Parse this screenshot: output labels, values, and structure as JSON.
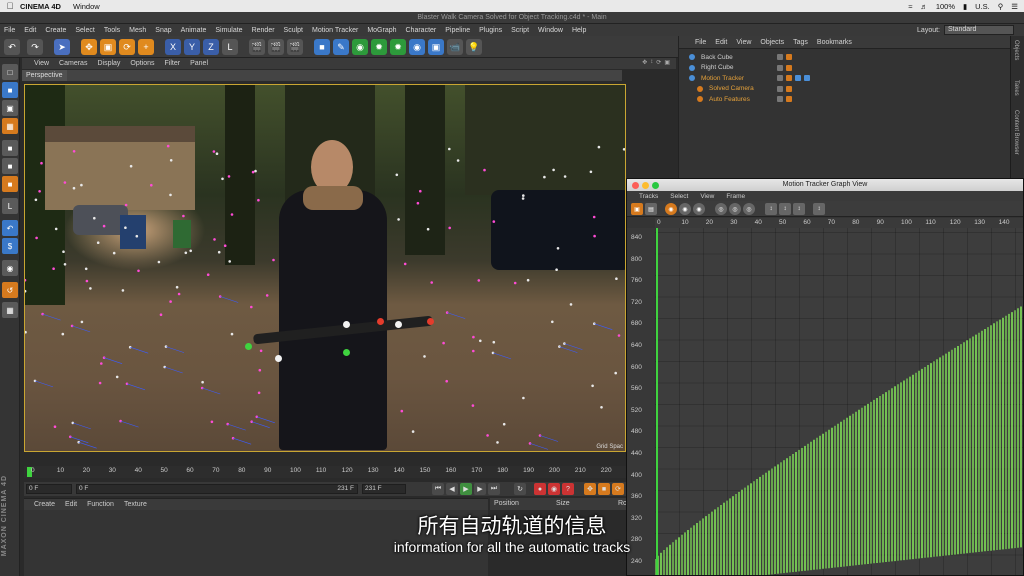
{
  "mac_menubar": {
    "app_name": "CINEMA 4D",
    "menu": "Window",
    "battery": "100%",
    "input_source": "U.S."
  },
  "window_title": "Blaster Walk Camera Solved for Object Tracking.c4d * - Main",
  "main_menu": [
    "File",
    "Edit",
    "Create",
    "Select",
    "Tools",
    "Mesh",
    "Snap",
    "Animate",
    "Simulate",
    "Render",
    "Sculpt",
    "Motion Tracker",
    "MoGraph",
    "Character",
    "Pipeline",
    "Plugins",
    "Script",
    "Window",
    "Help"
  ],
  "layout": {
    "label": "Layout:",
    "value": "Standard"
  },
  "viewport": {
    "menu": [
      "View",
      "Cameras",
      "Display",
      "Options",
      "Filter",
      "Panel"
    ],
    "label": "Perspective",
    "grid_spacing_label": "Grid Spac"
  },
  "timeline": {
    "ticks": [
      "0",
      "10",
      "20",
      "30",
      "40",
      "50",
      "60",
      "70",
      "80",
      "90",
      "100",
      "110",
      "120",
      "130",
      "140",
      "150",
      "160",
      "170",
      "180",
      "190",
      "200",
      "210",
      "220",
      "23"
    ]
  },
  "playback": {
    "start_field": "0 F",
    "range_start": "0 F",
    "range_end": "231 F",
    "end_field": "231 F"
  },
  "material_manager": {
    "menu": [
      "Create",
      "Edit",
      "Function",
      "Texture"
    ]
  },
  "attributes": {
    "columns": [
      "Position",
      "Size",
      "Ro"
    ]
  },
  "object_manager": {
    "menu": [
      "File",
      "Edit",
      "View",
      "Objects",
      "Tags",
      "Bookmarks"
    ],
    "objects": [
      {
        "name": "Back Cube",
        "highlight": false
      },
      {
        "name": "Right Cube",
        "highlight": false
      },
      {
        "name": "Motion Tracker",
        "highlight": true
      },
      {
        "name": "Solved Camera",
        "highlight": true
      },
      {
        "name": "Auto Features",
        "highlight": true
      }
    ]
  },
  "right_tabs": [
    "Objects",
    "Takes",
    "Content Browser",
    "Structure"
  ],
  "graph_view": {
    "title": "Motion Tracker Graph View",
    "menu": [
      "Tracks",
      "Select",
      "View",
      "Frame"
    ],
    "x_ticks": [
      "0",
      "10",
      "20",
      "30",
      "40",
      "50",
      "60",
      "70",
      "80",
      "90",
      "100",
      "110",
      "120",
      "130",
      "140",
      "15"
    ],
    "y_ticks": [
      "840",
      "800",
      "760",
      "720",
      "680",
      "640",
      "600",
      "560",
      "520",
      "480",
      "440",
      "400",
      "360",
      "320",
      "280",
      "240"
    ]
  },
  "subtitles": {
    "chinese": "所有自动轨道的信息",
    "english": "information for all the automatic tracks"
  },
  "colors": {
    "accent_orange": "#e5a13a",
    "track_green": "#7ed957",
    "viewport_border": "#c9a632"
  }
}
